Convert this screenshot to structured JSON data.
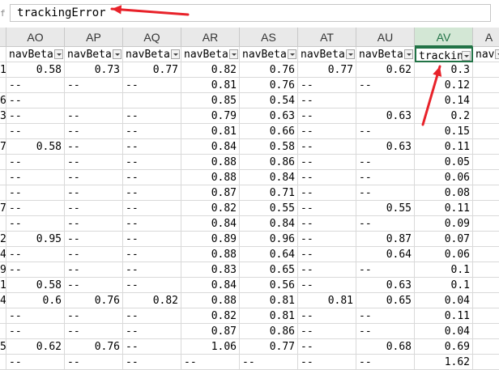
{
  "formula_bar": {
    "edge_glyph": "f",
    "value": "trackingError"
  },
  "columns": [
    {
      "letter": "",
      "header": ""
    },
    {
      "letter": "AO",
      "header": "navBeta"
    },
    {
      "letter": "AP",
      "header": "navBeta"
    },
    {
      "letter": "AQ",
      "header": "navBeta"
    },
    {
      "letter": "AR",
      "header": "navBeta"
    },
    {
      "letter": "AS",
      "header": "navBeta"
    },
    {
      "letter": "AT",
      "header": "navBeta"
    },
    {
      "letter": "AU",
      "header": "navBeta"
    },
    {
      "letter": "AV",
      "header": "trackin"
    },
    {
      "letter": "A",
      "header": "navBe"
    }
  ],
  "selected_column": "AV",
  "active_cell_header": "trackin",
  "rows": [
    [
      "1",
      "0.58",
      "0.73",
      "0.77",
      "0.82",
      "0.76",
      "0.77",
      "0.62",
      "0.3",
      ""
    ],
    [
      "",
      "--",
      "--",
      "--",
      "0.81",
      "0.76",
      "--",
      "--",
      "0.12",
      ""
    ],
    [
      "6",
      "--",
      "",
      "",
      "0.85",
      "0.54",
      "--",
      "",
      "0.14",
      ""
    ],
    [
      "3",
      "--",
      "--",
      "--",
      "0.79",
      "0.63",
      "--",
      "0.63",
      "0.2",
      ""
    ],
    [
      "",
      "--",
      "--",
      "--",
      "0.81",
      "0.66",
      "--",
      "--",
      "0.15",
      ""
    ],
    [
      "7",
      "0.58",
      "--",
      "--",
      "0.84",
      "0.58",
      "--",
      "0.63",
      "0.11",
      ""
    ],
    [
      "",
      "--",
      "--",
      "--",
      "0.88",
      "0.86",
      "--",
      "--",
      "0.05",
      ""
    ],
    [
      "",
      "--",
      "--",
      "--",
      "0.88",
      "0.84",
      "--",
      "--",
      "0.06",
      ""
    ],
    [
      "",
      "--",
      "--",
      "--",
      "0.87",
      "0.71",
      "--",
      "--",
      "0.08",
      ""
    ],
    [
      "7",
      "--",
      "--",
      "--",
      "0.82",
      "0.55",
      "--",
      "0.55",
      "0.11",
      ""
    ],
    [
      "",
      "--",
      "--",
      "--",
      "0.84",
      "0.84",
      "--",
      "--",
      "0.09",
      ""
    ],
    [
      "2",
      "0.95",
      "--",
      "--",
      "0.89",
      "0.96",
      "--",
      "0.87",
      "0.07",
      ""
    ],
    [
      "4",
      "--",
      "--",
      "--",
      "0.88",
      "0.64",
      "--",
      "0.64",
      "0.06",
      ""
    ],
    [
      "9",
      "--",
      "--",
      "--",
      "0.83",
      "0.65",
      "--",
      "--",
      "0.1",
      ""
    ],
    [
      "1",
      "0.58",
      "--",
      "--",
      "0.84",
      "0.56",
      "--",
      "0.63",
      "0.1",
      ""
    ],
    [
      "4",
      "0.6",
      "0.76",
      "0.82",
      "0.88",
      "0.81",
      "0.81",
      "0.65",
      "0.04",
      ""
    ],
    [
      "",
      "--",
      "--",
      "--",
      "0.82",
      "0.81",
      "--",
      "--",
      "0.11",
      ""
    ],
    [
      "",
      "--",
      "--",
      "--",
      "0.87",
      "0.86",
      "--",
      "--",
      "0.04",
      ""
    ],
    [
      "5",
      "0.62",
      "0.76",
      "--",
      "1.06",
      "0.77",
      "--",
      "0.68",
      "0.69",
      ""
    ],
    [
      "",
      "--",
      "--",
      "--",
      "--",
      "--",
      "--",
      "--",
      "1.62",
      ""
    ]
  ],
  "colors": {
    "accent": "#217346",
    "annotation": "#e8222a"
  }
}
